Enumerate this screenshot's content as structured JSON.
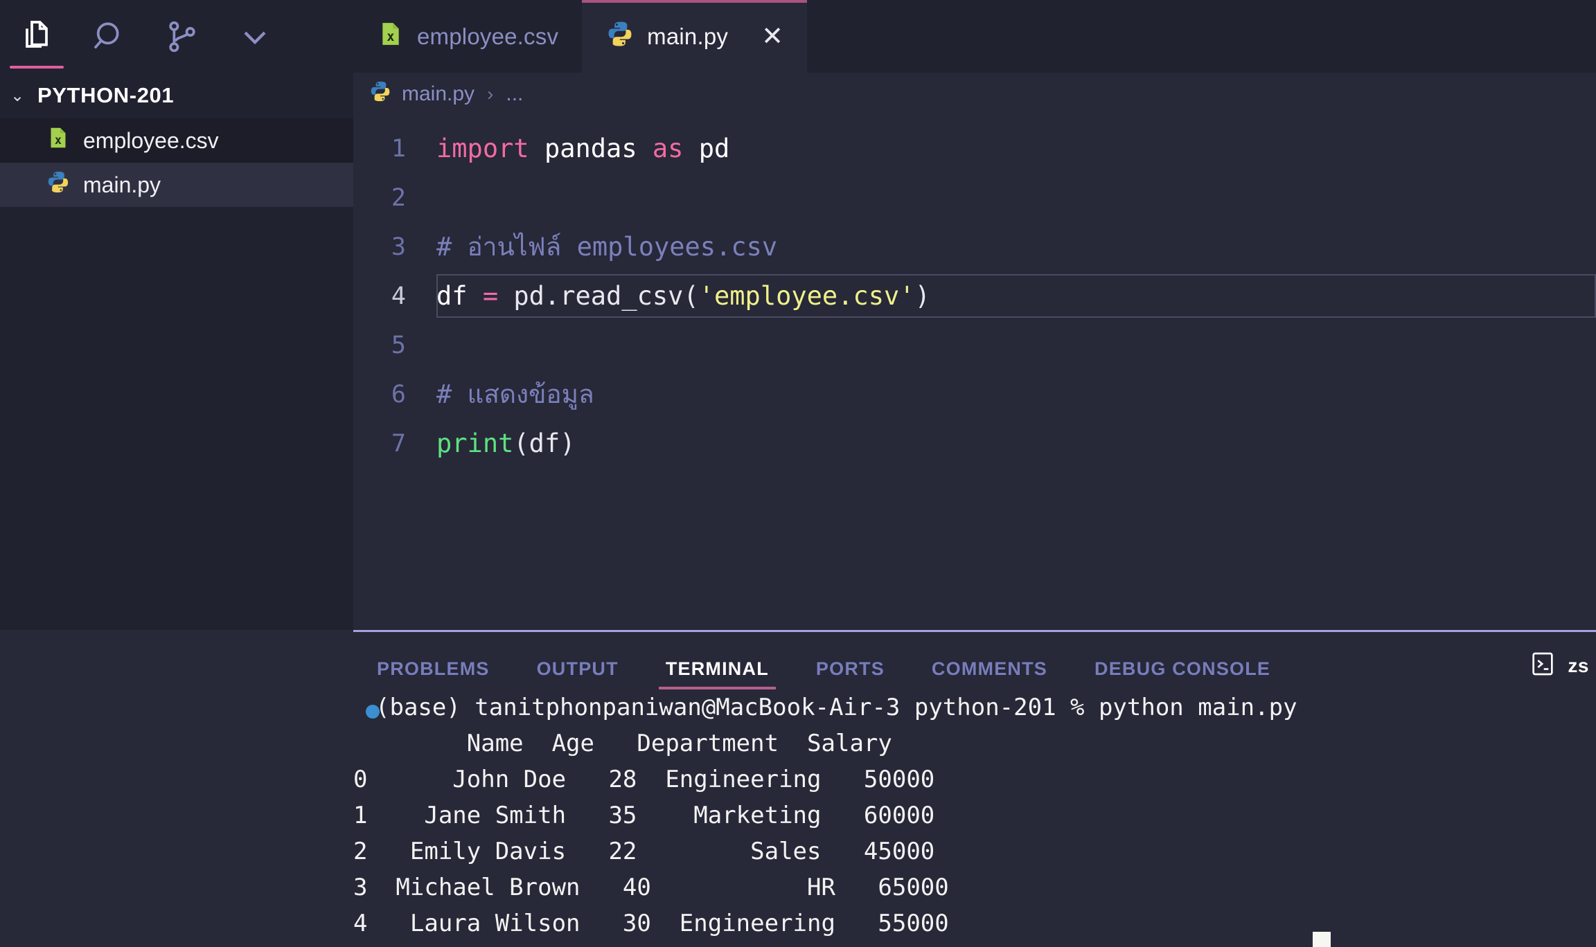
{
  "activitybar": {
    "items": [
      {
        "name": "explorer",
        "icon": "files-icon",
        "active": true
      },
      {
        "name": "search",
        "icon": "search-icon",
        "active": false
      },
      {
        "name": "source-control",
        "icon": "source-control-icon",
        "active": false
      },
      {
        "name": "more",
        "icon": "chevron-down-icon",
        "active": false
      }
    ]
  },
  "tabs": [
    {
      "label": "employee.csv",
      "icon": "csv-file-icon",
      "active": false
    },
    {
      "label": "main.py",
      "icon": "python-file-icon",
      "active": true,
      "close": "✕"
    }
  ],
  "sidebar": {
    "folder": {
      "label": "PYTHON-201",
      "chevron": "⌄"
    },
    "files": [
      {
        "label": "employee.csv",
        "icon": "csv-file-icon",
        "state": "hover"
      },
      {
        "label": "main.py",
        "icon": "python-file-icon",
        "state": "selected"
      }
    ]
  },
  "breadcrumb": {
    "icon": "python-file-icon",
    "file": "main.py",
    "separator": "›",
    "symbol": "..."
  },
  "editor": {
    "lines": [
      {
        "num": "1",
        "active": false,
        "tokens": [
          {
            "t": "import",
            "c": "kw"
          },
          {
            "t": " ",
            "c": "pl"
          },
          {
            "t": "pandas",
            "c": "id"
          },
          {
            "t": " ",
            "c": "pl"
          },
          {
            "t": "as",
            "c": "kw"
          },
          {
            "t": " ",
            "c": "pl"
          },
          {
            "t": "pd",
            "c": "id"
          }
        ]
      },
      {
        "num": "2",
        "active": false,
        "tokens": []
      },
      {
        "num": "3",
        "active": false,
        "tokens": [
          {
            "t": "# อ่านไฟล์ employees.csv",
            "c": "cmt"
          }
        ]
      },
      {
        "num": "4",
        "active": true,
        "tokens": [
          {
            "t": "df",
            "c": "id"
          },
          {
            "t": " ",
            "c": "pl"
          },
          {
            "t": "=",
            "c": "kw"
          },
          {
            "t": " ",
            "c": "pl"
          },
          {
            "t": "pd.read_csv(",
            "c": "pl"
          },
          {
            "t": "'employee.csv'",
            "c": "str"
          },
          {
            "t": ")",
            "c": "pl"
          }
        ]
      },
      {
        "num": "5",
        "active": false,
        "tokens": []
      },
      {
        "num": "6",
        "active": false,
        "tokens": [
          {
            "t": "# แสดงข้อมูล",
            "c": "cmt"
          }
        ]
      },
      {
        "num": "7",
        "active": false,
        "tokens": [
          {
            "t": "print",
            "c": "fn"
          },
          {
            "t": "(df)",
            "c": "pl"
          }
        ]
      }
    ]
  },
  "panel": {
    "tabs": [
      {
        "label": "PROBLEMS",
        "active": false
      },
      {
        "label": "OUTPUT",
        "active": false
      },
      {
        "label": "TERMINAL",
        "active": true
      },
      {
        "label": "PORTS",
        "active": false
      },
      {
        "label": "COMMENTS",
        "active": false
      },
      {
        "label": "DEBUG CONSOLE",
        "active": false
      }
    ],
    "shell": {
      "icon": "terminal-icon",
      "label": "zs"
    }
  },
  "terminal": {
    "prompt": "(base) tanitphonpaniwan@MacBook-Air-3 python-201 % python main.py",
    "header": "        Name  Age   Department  Salary",
    "rows": [
      "0      John Doe   28  Engineering   50000",
      "1    Jane Smith   35    Marketing   60000",
      "2   Emily Davis   22        Sales   45000",
      "3  Michael Brown   40           HR   65000",
      "4   Laura Wilson   30  Engineering   55000"
    ]
  },
  "colors": {
    "accent_pink": "#e05f9e",
    "tab_active_border": "#a8547e",
    "panel_divider": "#a89fe0",
    "editor_bg": "#272838",
    "sidebar_bg": "#21222f",
    "keyword": "#f26ba2",
    "string": "#eef08a",
    "comment": "#7b80bb",
    "function": "#5ee27f"
  }
}
